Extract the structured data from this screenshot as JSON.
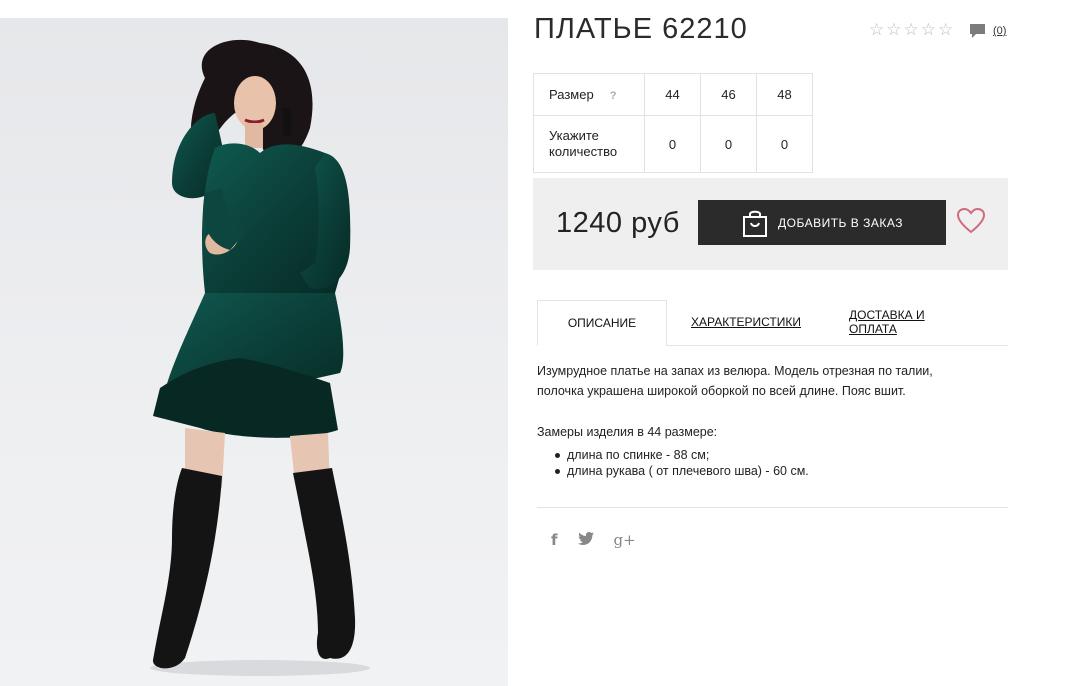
{
  "product": {
    "title": "ПЛАТЬЕ 62210",
    "rating_stars": 5,
    "review_count": "(0)",
    "price": "1240 руб",
    "add_button_label": "ДОБАВИТЬ В ЗАКАЗ"
  },
  "size_table": {
    "size_label": "Размер",
    "help_mark": "?",
    "sizes": [
      "44",
      "46",
      "48"
    ],
    "qty_label_1": "Укажите",
    "qty_label_2": "количество",
    "quantities": [
      "0",
      "0",
      "0"
    ]
  },
  "tabs": [
    {
      "label": "ОПИСАНИЕ",
      "active": true
    },
    {
      "label": "ХАРАКТЕРИСТИКИ",
      "active": false
    },
    {
      "label": "ДОСТАВКА И ОПЛАТА",
      "active": false
    }
  ],
  "description": {
    "line1": "Изумрудное платье на запах из велюра. Модель отрезная по талии,",
    "line2": "полочка украшена широкой оборкой по всей длине. Пояс вшит.",
    "measures_title": "Замеры изделия в 44 размере:",
    "measures": [
      "длина по спинке - 88 см;",
      "длина рукава ( от плечевого шва) - 60 см."
    ]
  },
  "social": {
    "facebook": "f",
    "twitter": "twitter-icon",
    "googleplus": "g+"
  },
  "colors": {
    "dress": "#0d4a42",
    "button": "#2b2b2b",
    "heart": "#d26a7e",
    "buybox": "#efefef"
  }
}
